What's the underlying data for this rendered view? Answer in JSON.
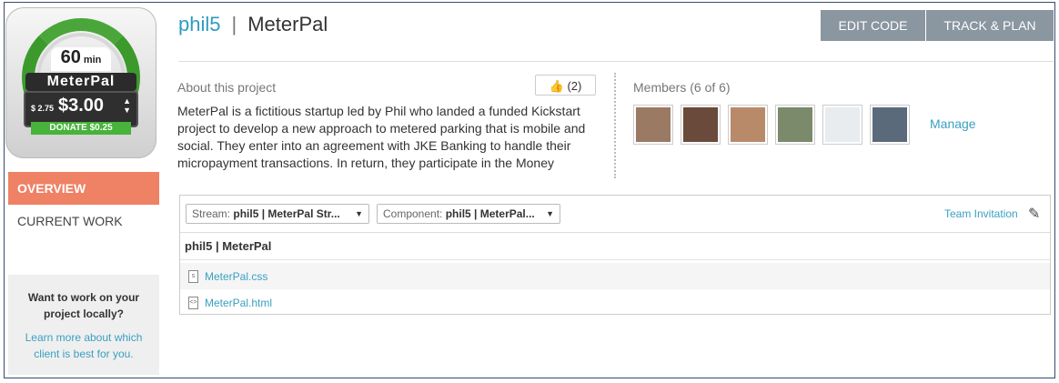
{
  "logo": {
    "minutes": "60",
    "minutes_unit": "min",
    "brand": "MeterPal",
    "small_price": "$ 2.75",
    "big_price": "$3.00",
    "donate": "DONATE $0.25"
  },
  "sidebar": {
    "items": [
      {
        "label": "OVERVIEW",
        "active": true
      },
      {
        "label": "CURRENT WORK",
        "active": false
      }
    ],
    "help": {
      "title": "Want to work on your project locally?",
      "link": "Learn more about which client is best for you."
    }
  },
  "header": {
    "user": "phil5",
    "separator": "|",
    "project": "MeterPal",
    "buttons": {
      "edit": "EDIT CODE",
      "track": "TRACK & PLAN"
    }
  },
  "about": {
    "label": "About this project",
    "like_count": "(2)",
    "text": "MeterPal is a fictitious startup led by Phil who landed a funded Kickstart project to develop a new approach to metered parking that is mobile and social. They enter into an agreement with JKE Banking to handle their micropayment transactions. In return, they participate in the Money"
  },
  "members": {
    "label": "Members (6 of 6)",
    "manage": "Manage",
    "avatars": [
      {
        "name": "member-1",
        "color": "#9a7a62"
      },
      {
        "name": "member-2",
        "color": "#6a4a3a"
      },
      {
        "name": "member-3",
        "color": "#b88a6a"
      },
      {
        "name": "member-4",
        "color": "#7a8a6a"
      },
      {
        "name": "member-5",
        "color": "#e8ecef"
      },
      {
        "name": "member-6",
        "color": "#5a6a7a"
      }
    ]
  },
  "files": {
    "stream_label": "Stream:",
    "stream_value": "phil5 | MeterPal Str...",
    "component_label": "Component:",
    "component_value": "phil5 | MeterPal...",
    "team_invitation": "Team Invitation",
    "project_label": "phil5 | MeterPal",
    "items": [
      {
        "name": "MeterPal.css",
        "icon": "css-file-icon"
      },
      {
        "name": "MeterPal.html",
        "icon": "html-file-icon"
      }
    ]
  },
  "colors": {
    "accent": "#2d9cc2",
    "nav_active": "#ef8164",
    "button": "#8a96a0",
    "link": "#3aa0c2"
  }
}
